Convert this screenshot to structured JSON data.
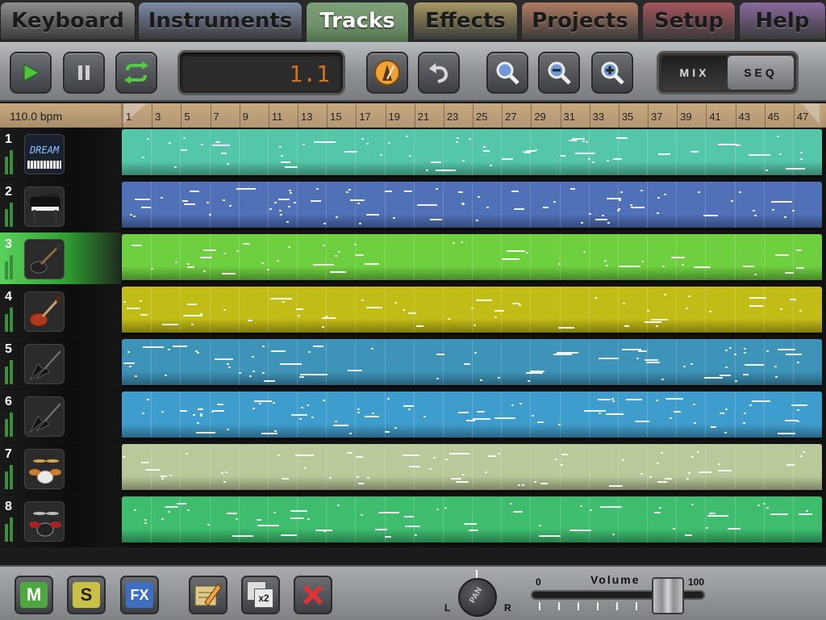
{
  "tabs": [
    {
      "label": "Keyboard",
      "color": "#8e8e8e"
    },
    {
      "label": "Instruments",
      "color": "#7d8aa6"
    },
    {
      "label": "Tracks",
      "color": "#6f8f6a",
      "active": true
    },
    {
      "label": "Effects",
      "color": "#a89863"
    },
    {
      "label": "Projects",
      "color": "#b07c62"
    },
    {
      "label": "Setup",
      "color": "#a5555e"
    },
    {
      "label": "Help",
      "color": "#8a6aa0"
    }
  ],
  "toolbar": {
    "play": "play-icon",
    "pause": "pause-icon",
    "loop": "loop-icon",
    "position": "1.1",
    "metronome": "metronome-icon",
    "undo": "undo-icon",
    "zoom": "zoom-icon",
    "zoom_out": "zoom-out-icon",
    "zoom_in": "zoom-in-icon",
    "mix_label": "MIX",
    "seq_label": "SEQ"
  },
  "ruler": {
    "tempo": "110.0 bpm",
    "bars": [
      "1",
      "3",
      "5",
      "7",
      "9",
      "11",
      "13",
      "15",
      "17",
      "19",
      "21",
      "23",
      "25",
      "27",
      "29",
      "31",
      "33",
      "35",
      "37",
      "39",
      "41",
      "43",
      "45",
      "47"
    ]
  },
  "tracks": [
    {
      "number": "1",
      "instrument": "synth",
      "icon_text": "DREAM",
      "color": "#55c7a9",
      "selected": false
    },
    {
      "number": "2",
      "instrument": "piano",
      "color": "#5070b8",
      "selected": false
    },
    {
      "number": "3",
      "instrument": "electric-guitar",
      "color": "#6ecf3f",
      "selected": true
    },
    {
      "number": "4",
      "instrument": "red-guitar",
      "color": "#c2bc16",
      "selected": false
    },
    {
      "number": "5",
      "instrument": "bass-guitar",
      "color": "#3e93b8",
      "selected": false
    },
    {
      "number": "6",
      "instrument": "bass-guitar",
      "color": "#3f9dcd",
      "selected": false
    },
    {
      "number": "7",
      "instrument": "drum-kit",
      "color": "#b9c99a",
      "selected": false
    },
    {
      "number": "8",
      "instrument": "drum-kit-black",
      "color": "#3fbd6f",
      "selected": false
    }
  ],
  "bottom": {
    "mute_label": "M",
    "solo_label": "S",
    "fx_label": "FX",
    "edit": "pencil-icon",
    "duplicate_label": "x2",
    "delete": "delete-icon",
    "pan_label": "PAN",
    "pan_left": "L",
    "pan_right": "R",
    "volume_label": "Volume",
    "volume_min": "0",
    "volume_max": "100",
    "volume_value": 77
  }
}
